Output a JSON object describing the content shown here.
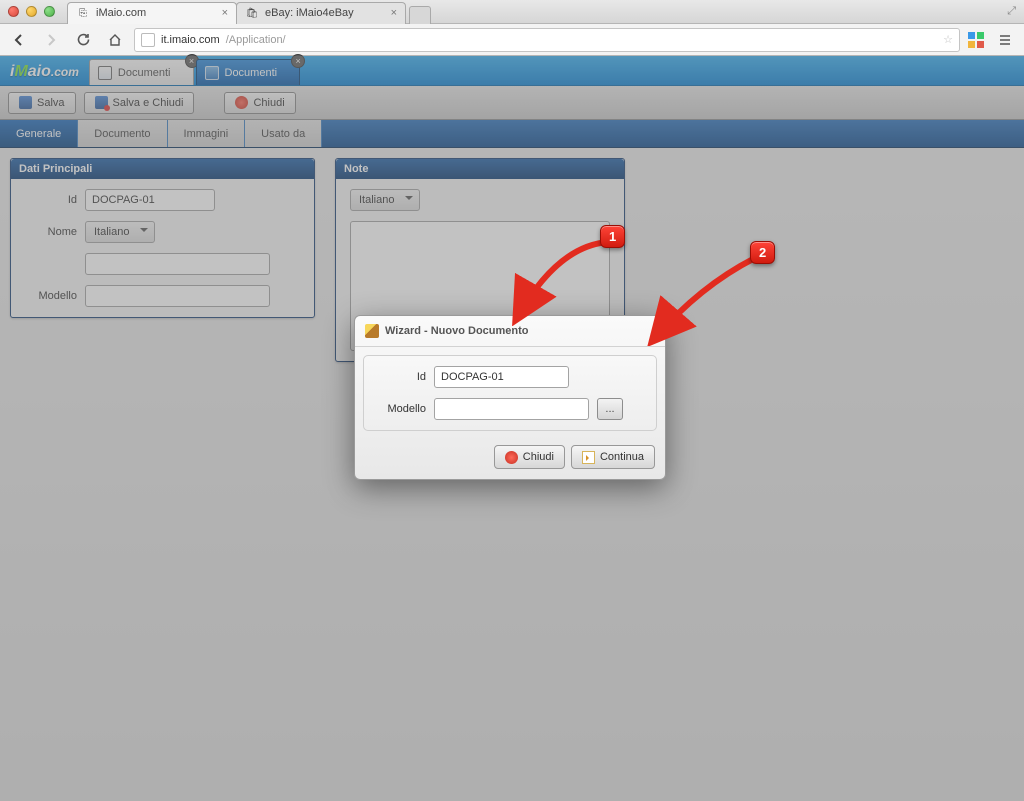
{
  "browser": {
    "tabs": [
      {
        "title": "iMaio.com"
      },
      {
        "title": "eBay: iMaio4eBay"
      }
    ],
    "url_host": "it.imaio.com",
    "url_path": "/Application/"
  },
  "app": {
    "brand_main": "iMaio",
    "brand_suffix": ".com",
    "tabs": [
      {
        "label": "Documenti",
        "active": false
      },
      {
        "label": "Documenti",
        "active": true
      }
    ]
  },
  "toolbar": {
    "save": "Salva",
    "save_close": "Salva e Chiudi",
    "close": "Chiudi"
  },
  "subtabs": {
    "general": "Generale",
    "document": "Documento",
    "images": "Immagini",
    "used_by": "Usato da"
  },
  "panel_main": {
    "title": "Dati Principali",
    "id_label": "Id",
    "id_value": "DOCPAG-01",
    "name_label": "Nome",
    "name_lang": "Italiano",
    "name_value": "",
    "model_label": "Modello",
    "model_value": ""
  },
  "panel_notes": {
    "title": "Note",
    "lang": "Italiano"
  },
  "wizard": {
    "title": "Wizard - Nuovo Documento",
    "id_label": "Id",
    "id_value": "DOCPAG-01",
    "model_label": "Modello",
    "model_value": "",
    "browse_label": "...",
    "close": "Chiudi",
    "continue": "Continua"
  },
  "callouts": {
    "one": "1",
    "two": "2"
  }
}
